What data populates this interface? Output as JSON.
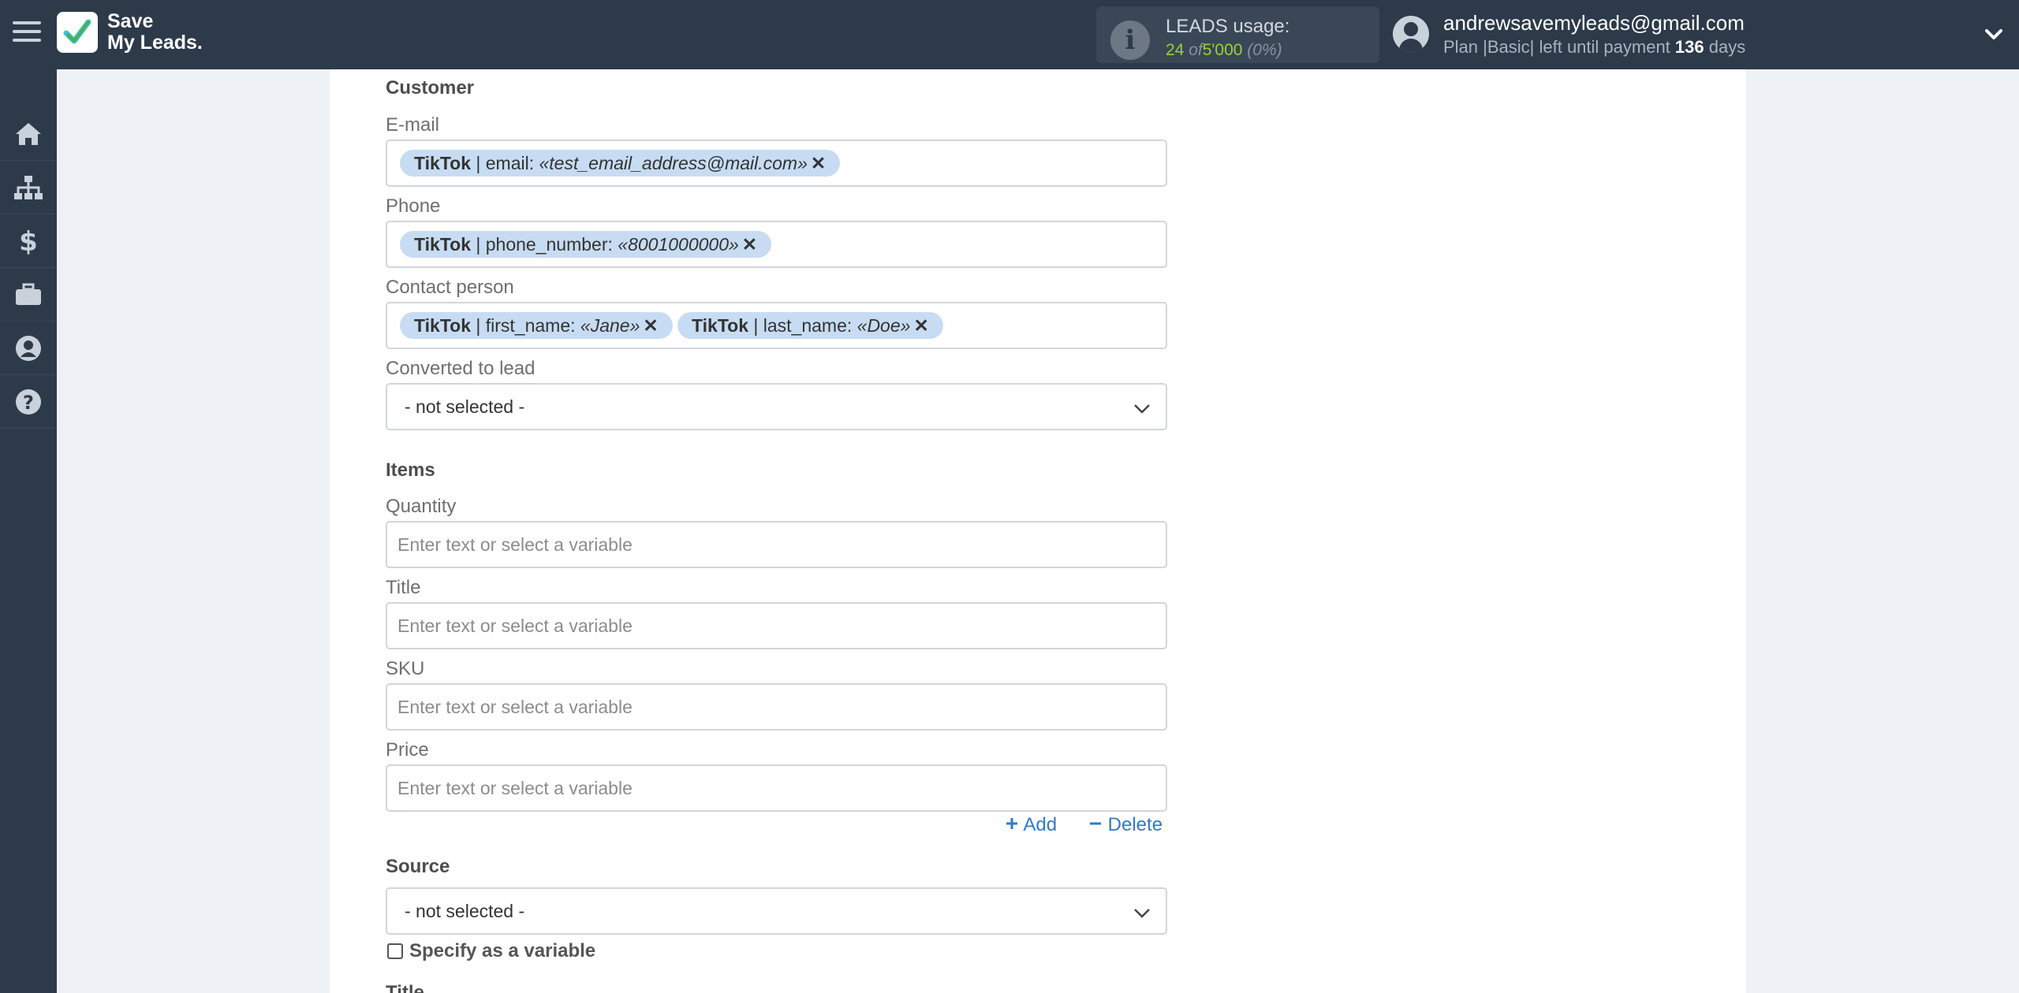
{
  "header": {
    "logo_line1": "Save",
    "logo_line2": "My Leads.",
    "usage_title": "LEADS usage:",
    "usage_used": "24",
    "usage_of": "of",
    "usage_total": "5'000",
    "usage_percent": "(0%)",
    "user_email": "andrewsavemyleads@gmail.com",
    "plan_prefix": "Plan |Basic| left until payment",
    "plan_days": "136",
    "plan_suffix": "days"
  },
  "sidebar": {
    "items": [
      "home-icon",
      "sitemap-icon",
      "dollar-icon",
      "briefcase-icon",
      "user-icon",
      "help-icon"
    ]
  },
  "form": {
    "customer_section": "Customer",
    "email_label": "E-mail",
    "email_tag": {
      "source": "TikTok",
      "field": "| email:",
      "value": "«test_email_address@mail.com»",
      "remove": "✕"
    },
    "phone_label": "Phone",
    "phone_tag": {
      "source": "TikTok",
      "field": "| phone_number:",
      "value": "«8001000000»",
      "remove": "✕"
    },
    "contact_label": "Contact person",
    "contact_tags": [
      {
        "source": "TikTok",
        "field": "| first_name:",
        "value": "«Jane»",
        "remove": "✕"
      },
      {
        "source": "TikTok",
        "field": "| last_name:",
        "value": "«Doe»",
        "remove": "✕"
      }
    ],
    "converted_label": "Converted to lead",
    "converted_value": "- not selected -",
    "items_section": "Items",
    "quantity_label": "Quantity",
    "title_label": "Title",
    "sku_label": "SKU",
    "price_label": "Price",
    "placeholder": "Enter text or select a variable",
    "add_label": "Add",
    "delete_label": "Delete",
    "source_section": "Source",
    "source_value": "- not selected -",
    "specify_variable_label": "Specify as a variable",
    "next_label_partial": "Title"
  },
  "colors": {
    "topbar": "#2d3a4a",
    "accent_link": "#2e7bc9",
    "tag_bg": "#c7dcf2",
    "usage_green": "#9ad13a"
  }
}
